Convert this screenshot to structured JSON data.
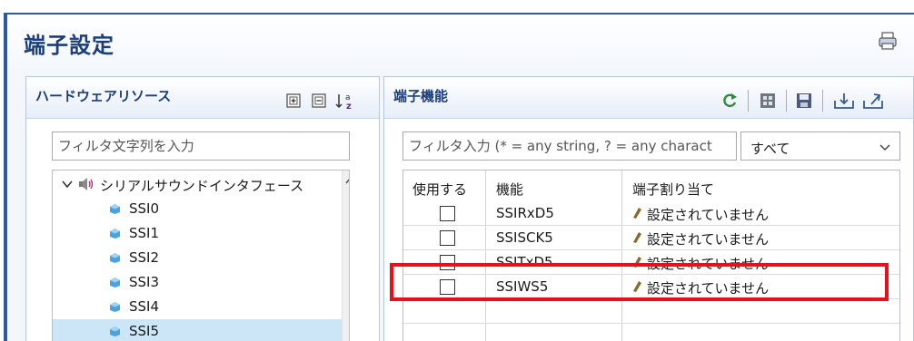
{
  "editor": {
    "title": "端子設定",
    "print_icon": "print-icon"
  },
  "hardware_panel": {
    "title": "ハードウェアリソース",
    "tools": [
      "expand-all-icon",
      "collapse-all-icon",
      "sort-az-icon"
    ],
    "filter_placeholder": "フィルタ文字列を入力",
    "tree": {
      "group": {
        "label": "シリアルサウンドインタフェース",
        "icon": "speaker-icon",
        "expanded": true
      },
      "items": [
        {
          "label": "SSI0",
          "selected": false
        },
        {
          "label": "SSI1",
          "selected": false
        },
        {
          "label": "SSI2",
          "selected": false
        },
        {
          "label": "SSI3",
          "selected": false
        },
        {
          "label": "SSI4",
          "selected": false
        },
        {
          "label": "SSI5",
          "selected": true
        }
      ]
    }
  },
  "pin_panel": {
    "title": "端子機能",
    "tools": [
      "refresh-icon",
      "grid-icon",
      "save-icon",
      "import-icon",
      "export-icon"
    ],
    "filter_placeholder": "フィルタ入力 (* = any string, ? = any charact",
    "select_value": "すべて",
    "columns": [
      "使用する",
      "機能",
      "端子割り当て"
    ],
    "rows": [
      {
        "use": false,
        "function": "SSIRxD5",
        "assignment": "設定されていません"
      },
      {
        "use": false,
        "function": "SSISCK5",
        "assignment": "設定されていません"
      },
      {
        "use": false,
        "function": "SSITxD5",
        "assignment": "設定されていません"
      },
      {
        "use": false,
        "function": "SSIWS5",
        "assignment": "設定されていません"
      }
    ],
    "highlighted_row": "SSIWS5"
  },
  "colors": {
    "title": "#1d3e7a",
    "highlight": "#e8111a",
    "selection": "#cde6f7"
  }
}
